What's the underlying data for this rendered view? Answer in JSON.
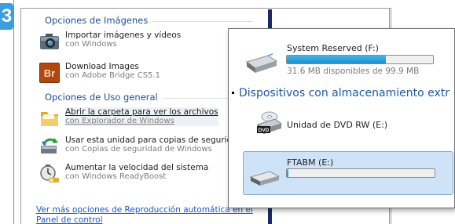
{
  "step_badge": "3",
  "autoplay": {
    "images_section_title": "Opciones de Imágenes",
    "general_section_title": "Opciones de Uso general",
    "import": {
      "main": "Importar imágenes y vídeos",
      "sub": "con Windows"
    },
    "bridge": {
      "main": "Download Images",
      "sub": "con Adobe Bridge CS5.1",
      "icon_text": "Br"
    },
    "open_folder": {
      "main": "Abrir la carpeta para ver los archivos",
      "sub": "con Explorador de Windows"
    },
    "backup": {
      "main": "Usar esta unidad para copias de seguridad",
      "sub": "con Copias de seguridad de Windows"
    },
    "readyboost": {
      "main": "Aumentar la velocidad del sistema",
      "sub": "con Windows ReadyBoost"
    },
    "more_link": "Ver más opciones de Reproducción automática en el Panel de control"
  },
  "computer": {
    "system_reserved": {
      "name": "System Reserved (F:)",
      "free": "31.6 MB disponibles de 99.9 MB",
      "used_fraction": 0.68
    },
    "removable_header": "Dispositivos con almacenamiento extr",
    "dvd": {
      "name": "Unidad de DVD RW (E:)",
      "icon_text": "DVD"
    },
    "usb": {
      "name": "FTABM (E:)",
      "used_fraction": 0.01
    }
  },
  "colors": {
    "accent": "#1f4e91",
    "link": "#1f56c4",
    "capacity_fill": "#26a0da",
    "selection": "#cfe3f8",
    "badge": "#3a9ee0"
  },
  "icons": [
    "camera-icon",
    "adobe-bridge-icon",
    "folder-icon",
    "backup-icon",
    "readyboost-icon",
    "hard-drive-icon",
    "dvd-drive-icon",
    "usb-drive-icon"
  ]
}
